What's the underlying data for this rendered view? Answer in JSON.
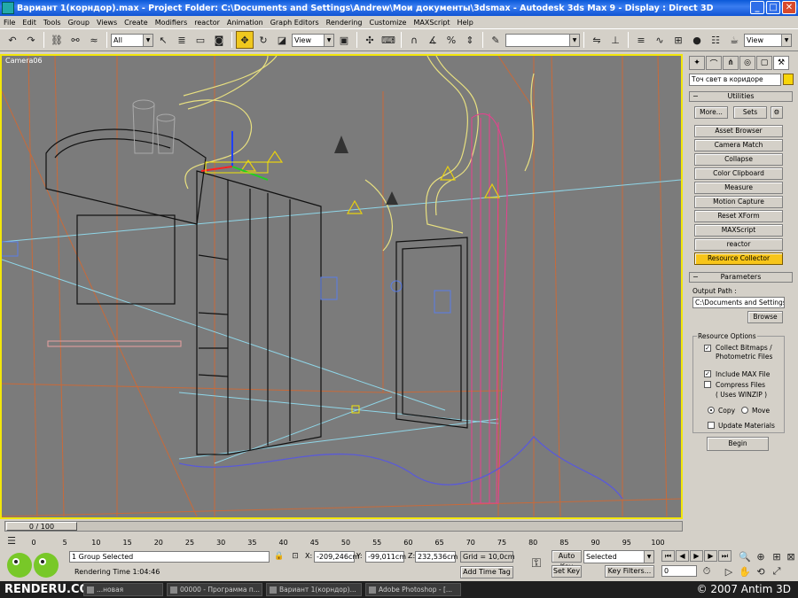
{
  "window": {
    "title": "Вариант 1(корндор).max    - Project Folder: C:\\Documents and Settings\\Andrew\\Мои документы\\3dsmax    - Autodesk 3ds Max 9    - Display : Direct 3D",
    "buttons": [
      "minimize",
      "maximize",
      "close"
    ]
  },
  "menu": [
    "File",
    "Edit",
    "Tools",
    "Group",
    "Views",
    "Create",
    "Modifiers",
    "reactor",
    "Animation",
    "Graph Editors",
    "Rendering",
    "Customize",
    "MAXScript",
    "Help"
  ],
  "toolbar": {
    "selection_filter": "All",
    "coord_system": "View",
    "named_selection": "",
    "right_view": "View"
  },
  "viewport": {
    "label": "Camera06",
    "border_color": "#f2e60a",
    "background": "#7b7b7b"
  },
  "command_panel": {
    "tab_icons": [
      "create-icon",
      "modify-icon",
      "hierarchy-icon",
      "motion-icon",
      "display-icon",
      "utilities-icon"
    ],
    "object_name": "Точ свет в коридоре",
    "object_color": "#f7d50a",
    "utilities": {
      "header": "Utilities",
      "more": "More...",
      "sets": "Sets",
      "items": [
        "Asset Browser",
        "Camera Match",
        "Collapse",
        "Color Clipboard",
        "Measure",
        "Motion Capture",
        "Reset XForm",
        "MAXScript",
        "reactor",
        "Resource Collector"
      ],
      "active": "Resource Collector"
    },
    "parameters": {
      "header": "Parameters",
      "output_path_label": "Output Path :",
      "output_path": "C:\\Documents and Settings\\A",
      "browse": "Browse",
      "resource_options_label": "Resource Options",
      "collect_bitmaps": "Collect Bitmaps / Photometric Files",
      "collect_bitmaps_checked": true,
      "include_max": "Include MAX File",
      "include_max_checked": true,
      "compress_files": "Compress Files",
      "compress_files_sub": "( Uses WINZIP )",
      "compress_checked": false,
      "copy": "Copy",
      "move": "Move",
      "copy_selected": true,
      "update_materials": "Update Materials",
      "update_materials_checked": false,
      "begin": "Begin"
    }
  },
  "timeline": {
    "frame_display": "0 / 100",
    "ticks": [
      "0",
      "5",
      "10",
      "15",
      "20",
      "25",
      "30",
      "35",
      "40",
      "45",
      "50",
      "55",
      "60",
      "65",
      "70",
      "75",
      "80",
      "85",
      "90",
      "95",
      "100"
    ]
  },
  "status": {
    "selection": "1 Group Selected",
    "prompt": "Rendering Time  1:04:46",
    "x_label": "X:",
    "x": "-209,246cm",
    "y_label": "Y:",
    "y": "-99,011cm",
    "z_label": "Z:",
    "z": "232,536cm",
    "grid": "Grid = 10,0cm",
    "add_time_tag": "Add Time Tag",
    "auto_key": "Auto Key",
    "set_key": "Set Key",
    "key_filter_value": "Selected",
    "key_filters": "Key Filters...",
    "frame_field": "0"
  },
  "taskbar": {
    "brand": "RENDERU.COM",
    "tasks": [
      "...новая",
      "00000 - Программа п...",
      "Вариант 1(корндор)...",
      "Adobe Photoshop - [..."
    ],
    "copyright": "© 2007 Antim 3D"
  }
}
